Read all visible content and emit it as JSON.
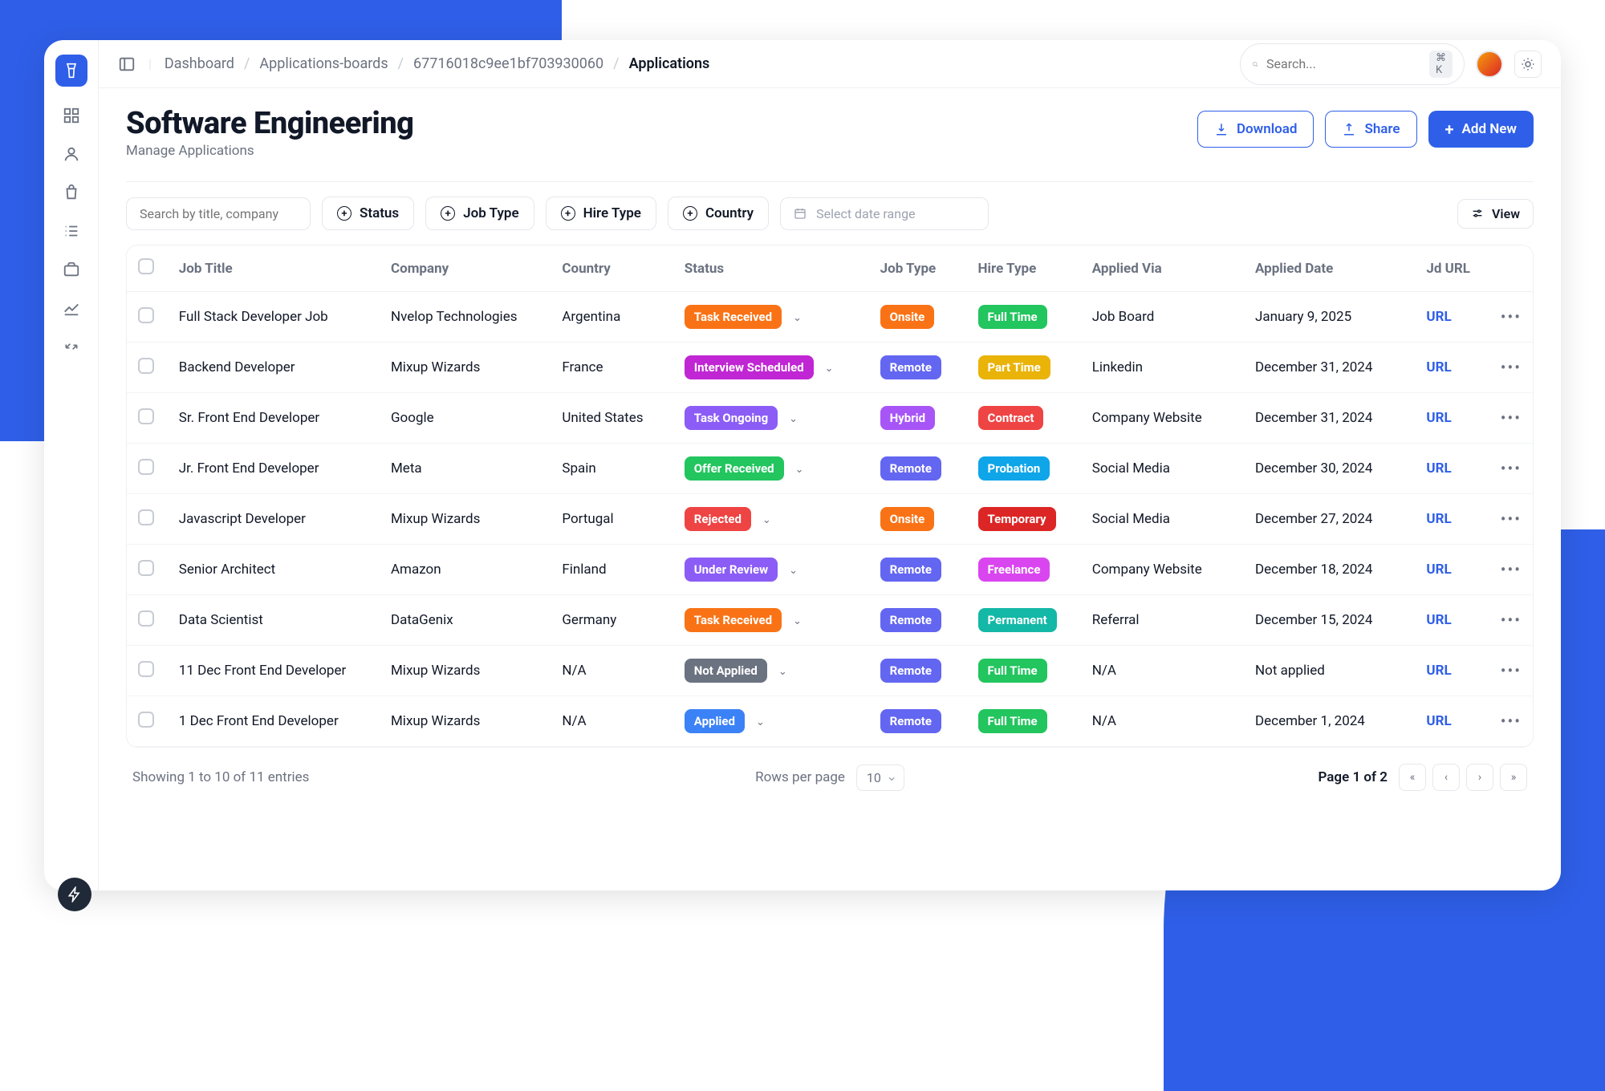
{
  "breadcrumbs": [
    "Dashboard",
    "Applications-boards",
    "67716018c9ee1bf703930060",
    "Applications"
  ],
  "search": {
    "placeholder": "Search...",
    "shortcut": "⌘ K"
  },
  "page": {
    "title": "Software Engineering",
    "subtitle": "Manage Applications"
  },
  "actions": {
    "download": "Download",
    "share": "Share",
    "add": "Add New"
  },
  "filters": {
    "search_placeholder": "Search by title, company",
    "status": "Status",
    "jobtype": "Job Type",
    "hiretype": "Hire Type",
    "country": "Country",
    "date_placeholder": "Select date range",
    "view": "View"
  },
  "columns": {
    "title": "Job Title",
    "company": "Company",
    "country": "Country",
    "status": "Status",
    "jobtype": "Job Type",
    "hiretype": "Hire Type",
    "via": "Applied Via",
    "date": "Applied Date",
    "url": "Jd URL"
  },
  "url_label": "URL",
  "status_colors": {
    "Task Received": "#f97316",
    "Interview Scheduled": "#c026d3",
    "Task Ongoing": "#8b5cf6",
    "Offer Received": "#22c55e",
    "Rejected": "#ef4444",
    "Under Review": "#8b5cf6",
    "Not Applied": "#6b7280",
    "Applied": "#3b82f6"
  },
  "jobtype_colors": {
    "Onsite": "#f97316",
    "Remote": "#6366f1",
    "Hybrid": "#a855f7"
  },
  "hiretype_colors": {
    "Full Time": "#22c55e",
    "Part Time": "#eab308",
    "Contract": "#ef4444",
    "Probation": "#0ea5e9",
    "Temporary": "#dc2626",
    "Freelance": "#d946ef",
    "Permanent": "#14b8a6"
  },
  "rows": [
    {
      "title": "Full Stack Developer Job",
      "company": "Nvelop Technologies",
      "country": "Argentina",
      "status": "Task Received",
      "jobtype": "Onsite",
      "hiretype": "Full Time",
      "via": "Job Board",
      "date": "January 9, 2025"
    },
    {
      "title": "Backend Developer",
      "company": "Mixup Wizards",
      "country": "France",
      "status": "Interview Scheduled",
      "jobtype": "Remote",
      "hiretype": "Part Time",
      "via": "Linkedin",
      "date": "December 31, 2024"
    },
    {
      "title": "Sr. Front End Developer",
      "company": "Google",
      "country": "United States",
      "status": "Task Ongoing",
      "jobtype": "Hybrid",
      "hiretype": "Contract",
      "via": "Company Website",
      "date": "December 31, 2024"
    },
    {
      "title": "Jr. Front End Developer",
      "company": "Meta",
      "country": "Spain",
      "status": "Offer Received",
      "jobtype": "Remote",
      "hiretype": "Probation",
      "via": "Social Media",
      "date": "December 30, 2024"
    },
    {
      "title": "Javascript Developer",
      "company": "Mixup Wizards",
      "country": "Portugal",
      "status": "Rejected",
      "jobtype": "Onsite",
      "hiretype": "Temporary",
      "via": "Social Media",
      "date": "December 27, 2024"
    },
    {
      "title": "Senior Architect",
      "company": "Amazon",
      "country": "Finland",
      "status": "Under Review",
      "jobtype": "Remote",
      "hiretype": "Freelance",
      "via": "Company Website",
      "date": "December 18, 2024"
    },
    {
      "title": "Data Scientist",
      "company": "DataGenix",
      "country": "Germany",
      "status": "Task Received",
      "jobtype": "Remote",
      "hiretype": "Permanent",
      "via": "Referral",
      "date": "December 15, 2024"
    },
    {
      "title": "11 Dec Front End Developer",
      "company": "Mixup Wizards",
      "country": "N/A",
      "status": "Not Applied",
      "jobtype": "Remote",
      "hiretype": "Full Time",
      "via": "N/A",
      "date": "Not applied"
    },
    {
      "title": "1 Dec Front End Developer",
      "company": "Mixup Wizards",
      "country": "N/A",
      "status": "Applied",
      "jobtype": "Remote",
      "hiretype": "Full Time",
      "via": "N/A",
      "date": "December 1, 2024"
    }
  ],
  "footer": {
    "summary": "Showing 1 to 10 of 11 entries",
    "rows_label": "Rows per page",
    "rows_value": "10",
    "page_label": "Page 1 of 2"
  }
}
